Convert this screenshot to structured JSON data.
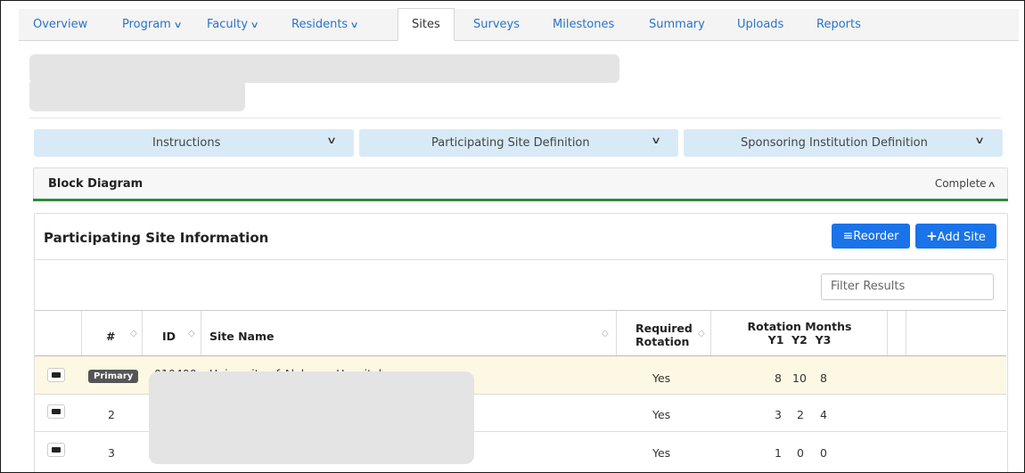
{
  "nav": {
    "tabs": [
      {
        "label": "Overview"
      },
      {
        "label": "Program",
        "has_menu": true
      },
      {
        "label": "Faculty",
        "has_menu": true
      },
      {
        "label": "Residents",
        "has_menu": true
      },
      {
        "label": "Sites",
        "active": true
      },
      {
        "label": "Surveys"
      },
      {
        "label": "Milestones"
      },
      {
        "label": "Summary"
      },
      {
        "label": "Uploads"
      },
      {
        "label": "Reports"
      }
    ]
  },
  "accordions": [
    {
      "label": "Instructions"
    },
    {
      "label": "Participating Site Definition"
    },
    {
      "label": "Sponsoring Institution Definition"
    }
  ],
  "block_diagram": {
    "title": "Block Diagram",
    "status": "Complete"
  },
  "participating_sites": {
    "title": "Participating Site Information",
    "reorder_label": "Reorder",
    "add_label": "Add Site",
    "filter_placeholder": "Filter Results",
    "columns": {
      "number": "#",
      "id": "ID",
      "site_name": "Site Name",
      "required_line1": "Required",
      "required_line2": "Rotation",
      "rotation_months": "Rotation Months",
      "y1": "Y1",
      "y2": "Y2",
      "y3": "Y3"
    },
    "rows": [
      {
        "number": "Primary",
        "id": "010400",
        "site_name": "University of Alabama Hospital",
        "required": "Yes",
        "y1": "8",
        "y2": "10",
        "y3": "8"
      },
      {
        "number": "2",
        "id": "",
        "site_name": "",
        "required": "Yes",
        "y1": "3",
        "y2": "2",
        "y3": "4"
      },
      {
        "number": "3",
        "id": "",
        "site_name": "",
        "required": "Yes",
        "y1": "1",
        "y2": "0",
        "y3": "0"
      }
    ]
  },
  "colors": {
    "link": "#2a74c7",
    "primary_button": "#1a73e8",
    "accordion": "#d9eaf7",
    "primary_row": "#fcf8e3",
    "complete_bar": "#2e8b3e"
  }
}
